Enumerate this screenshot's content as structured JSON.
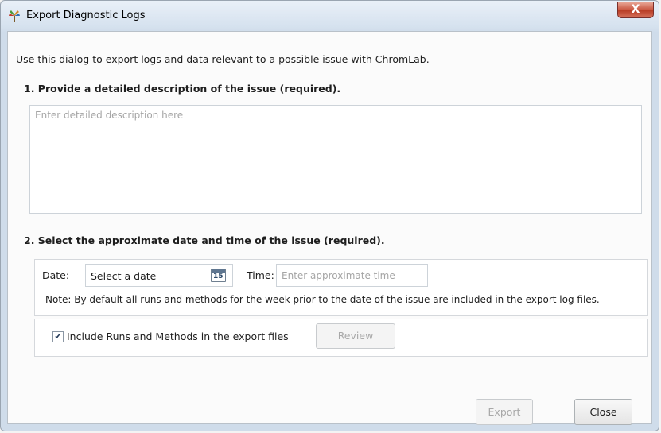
{
  "window": {
    "title": "Export Diagnostic Logs",
    "close_glyph": "X"
  },
  "intro": "Use this dialog to export logs and data relevant to a possible issue with ChromLab.",
  "section1": {
    "title": "1. Provide a detailed description of the issue (required).",
    "placeholder": "Enter detailed description here"
  },
  "section2": {
    "title": "2. Select the approximate date and time of the issue (required).",
    "date_label": "Date:",
    "date_value": "Select a date",
    "calendar_day": "15",
    "time_label": "Time:",
    "time_placeholder": "Enter approximate time",
    "note": "Note: By default all runs and methods for the week prior to the date of the issue are included in the export log files."
  },
  "include": {
    "checked": true,
    "check_glyph": "✔",
    "label": "Include Runs and Methods in the export files",
    "review_label": "Review"
  },
  "footer": {
    "export_label": "Export",
    "close_label": "Close"
  },
  "icons": [
    "app-logo-icon",
    "close-icon",
    "calendar-icon",
    "checkbox-check-icon"
  ]
}
